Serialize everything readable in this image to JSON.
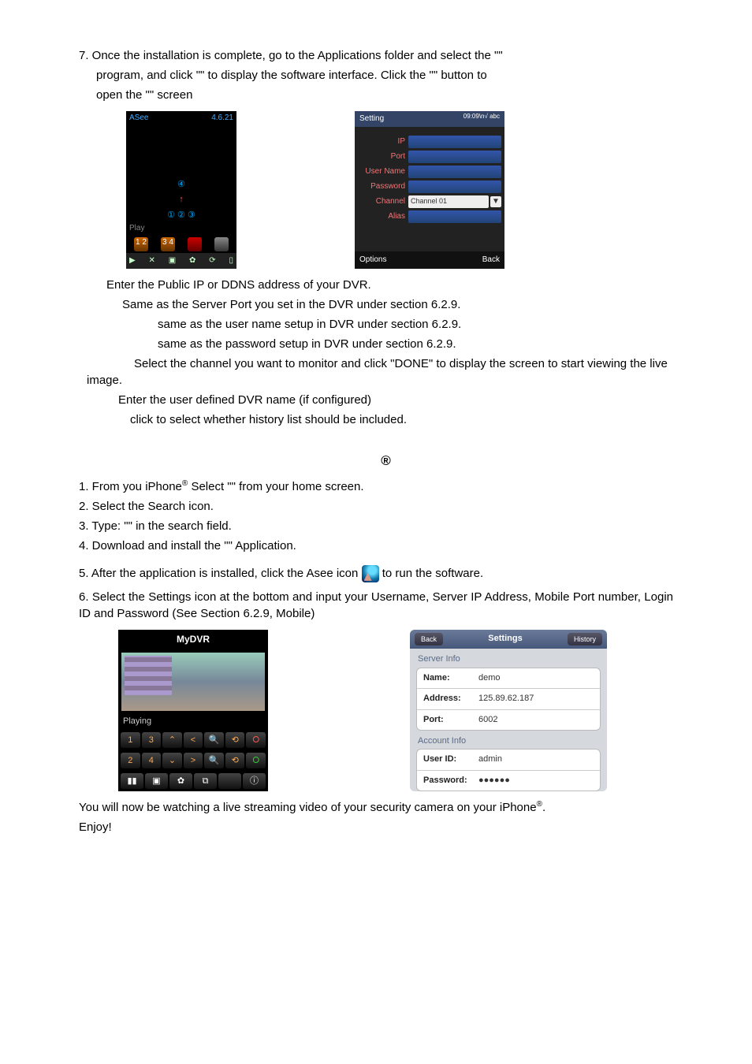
{
  "step7": {
    "line1a": "7. Once the installation is complete, go to the Applications folder and select the \"",
    "line1b": "\"",
    "line2a": "program, and click \"",
    "line2b": "\" to display the software interface.    Click the \"",
    "line2c": "\" button to",
    "line3a": "open the \"",
    "line3b": "\" screen"
  },
  "bbLive": {
    "header_left": "ASee",
    "header_right": "4.6.21",
    "marker4": "④",
    "marker_arrow": "↑",
    "markers_row": "①    ②    ③",
    "play": "Play",
    "icons": [
      "1 2",
      "3 4",
      "",
      "",
      ""
    ],
    "footer_icons": [
      "▶",
      "✕",
      "▣",
      "✿",
      "⟳",
      "▯"
    ]
  },
  "bbSettings": {
    "title": "Setting",
    "top_right": "09:09\\n√ abc",
    "rows": [
      {
        "lbl": "IP",
        "val": ""
      },
      {
        "lbl": "Port",
        "val": ""
      },
      {
        "lbl": "User Name",
        "val": ""
      },
      {
        "lbl": "Password",
        "val": ""
      },
      {
        "lbl": "Channel",
        "val": "Channel 01"
      },
      {
        "lbl": "Alias",
        "val": ""
      }
    ],
    "footer_left": "Options",
    "footer_right": "Back"
  },
  "defs": {
    "ip": "Enter the Public IP or DDNS address of your DVR.",
    "port": "Same as the Server Port you set in the DVR under section 6.2.9.",
    "user": "same as the user name setup in DVR under section 6.2.9.",
    "pass": "same as the password setup in DVR under section 6.2.9.",
    "channel": "Select the channel you want to monitor and click \"DONE\" to display the screen to start viewing the live image.",
    "alias": "Enter the user defined DVR name (if configured)",
    "history": "click to select whether history list should be included."
  },
  "iphone_title_sup": "®",
  "steps": {
    "s1a": "1. From you iPhone",
    "s1_sup": "®",
    "s1b": " Select \"",
    "s1c": "\" from your home screen.",
    "s2": "2. Select the Search icon.",
    "s3a": "3. Type: \"",
    "s3b": "\" in the search field.",
    "s4a": "4. Download and install the \"",
    "s4b": "\" Application.",
    "s5a": "5. After the application is installed, click the Asee icon ",
    "s5b": " to run the software.",
    "s6": "6. Select  the  Settings  icon  at  the  bottom  and  input  your  Username,  Server  IP  Address, Mobile Port number, Login ID and Password (See Section 6.2.9, Mobile)"
  },
  "iphoneLive": {
    "title": "MyDVR",
    "playing": "Playing",
    "row1": [
      "1",
      "3",
      "⌃",
      "<",
      "🔍",
      "⟲",
      "⭘"
    ],
    "row2": [
      "2",
      "4",
      "⌄",
      ">",
      "🔍",
      "⟲",
      "⭘"
    ],
    "row3": [
      "▮▮",
      "▣",
      "✿",
      "⧉",
      "",
      "ⓘ",
      ""
    ]
  },
  "iphoneSettings": {
    "back": "Back",
    "title": "Settings",
    "history": "History",
    "grp1_label": "Server Info",
    "grp1": [
      {
        "k": "Name:",
        "v": "demo"
      },
      {
        "k": "Address:",
        "v": "125.89.62.187"
      },
      {
        "k": "Port:",
        "v": "6002"
      }
    ],
    "grp2_label": "Account Info",
    "grp2": [
      {
        "k": "User ID:",
        "v": "admin"
      },
      {
        "k": "Password:",
        "v": "●●●●●●"
      }
    ]
  },
  "closing": {
    "l1a": "You will now be watching a live streaming video of your security camera on your iPhone",
    "l1_sup": "®",
    "l1b": ".",
    "l2": "Enjoy!"
  }
}
